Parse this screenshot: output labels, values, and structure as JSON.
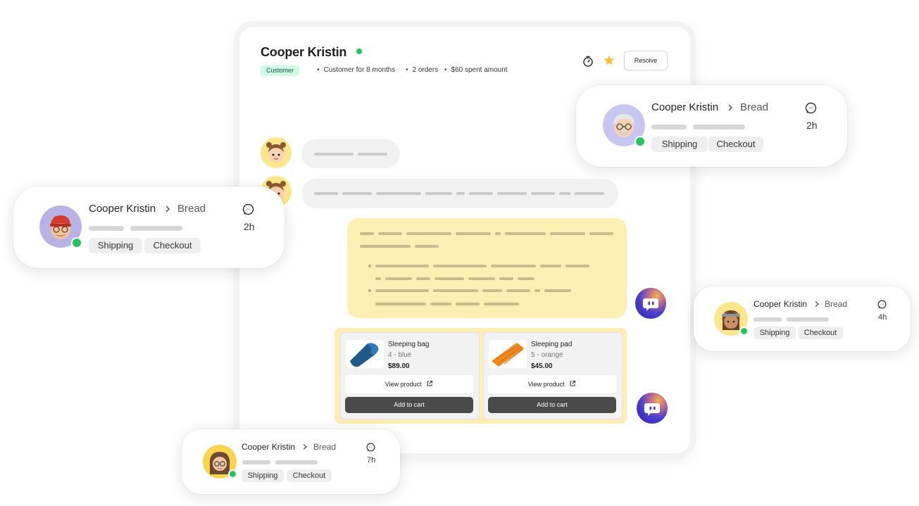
{
  "header": {
    "customer_name": "Cooper Kristin",
    "badge": "Customer",
    "meta": [
      "Customer for 8 months",
      "2 orders",
      "$60 spent amount"
    ],
    "resolve_label": "Resolve"
  },
  "products": [
    {
      "name": "Sleeping bag",
      "variant": "4 - blue",
      "price": "$89.00",
      "view_label": "View product",
      "cart_label": "Add to cart",
      "color": "#1e5a8a"
    },
    {
      "name": "Sleeping pad",
      "variant": "5 - orange",
      "price": "$45.00",
      "view_label": "View product",
      "cart_label": "Add to cart",
      "color": "#f08a1c"
    }
  ],
  "conversations": [
    {
      "name": "Cooper Kristin",
      "channel": "Bread",
      "time": "2h",
      "tags": [
        "Shipping",
        "Checkout"
      ],
      "icon": "messenger-icon"
    },
    {
      "name": "Cooper Kristin",
      "channel": "Bread",
      "time": "2h",
      "tags": [
        "Shipping",
        "Checkout"
      ],
      "icon": "messenger-icon"
    },
    {
      "name": "Cooper Kristin",
      "channel": "Bread",
      "time": "4h",
      "tags": [
        "Shipping",
        "Checkout"
      ],
      "icon": "messenger-icon"
    },
    {
      "name": "Cooper Kristin",
      "channel": "Bread",
      "time": "7h",
      "tags": [
        "Shipping",
        "Checkout"
      ],
      "icon": "messenger-icon"
    }
  ],
  "colors": {
    "online": "#22c55e",
    "bubble_yellow": "#fdeeb4",
    "badge_bg": "#d1fae5"
  }
}
